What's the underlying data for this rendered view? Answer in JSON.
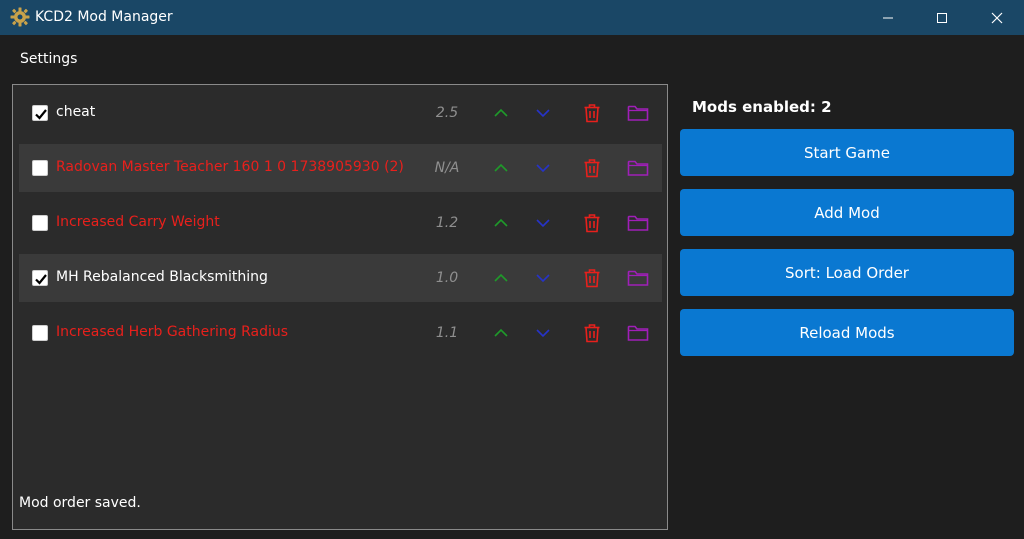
{
  "window": {
    "title": "KCD2 Mod Manager"
  },
  "menu": {
    "settings_label": "Settings"
  },
  "mods": [
    {
      "name": "cheat",
      "version": "2.5",
      "enabled": true
    },
    {
      "name": "Radovan Master Teacher 160 1 0 1738905930 (2)",
      "version": "N/A",
      "enabled": false
    },
    {
      "name": "Increased Carry Weight",
      "version": "1.2",
      "enabled": false
    },
    {
      "name": "MH Rebalanced Blacksmithing",
      "version": "1.0",
      "enabled": true
    },
    {
      "name": "Increased Herb Gathering Radius",
      "version": "1.1",
      "enabled": false
    }
  ],
  "status": {
    "message": "Mod order saved."
  },
  "sidebar": {
    "mods_enabled_label": "Mods enabled: 2",
    "start_game_label": "Start Game",
    "add_mod_label": "Add Mod",
    "sort_label": "Sort: Load Order",
    "reload_label": "Reload Mods"
  },
  "colors": {
    "titlebar": "#1a4766",
    "accent_button": "#0a78d1",
    "disabled_mod_text": "#e8201c",
    "up_arrow": "#1f9a2a",
    "down_arrow": "#2633c9",
    "delete_icon": "#e8201c",
    "folder_icon": "#a01fb8"
  },
  "icons": {
    "app": "gear-icon",
    "up": "chevron-up-icon",
    "down": "chevron-down-icon",
    "delete": "trash-icon",
    "folder": "folder-icon"
  }
}
